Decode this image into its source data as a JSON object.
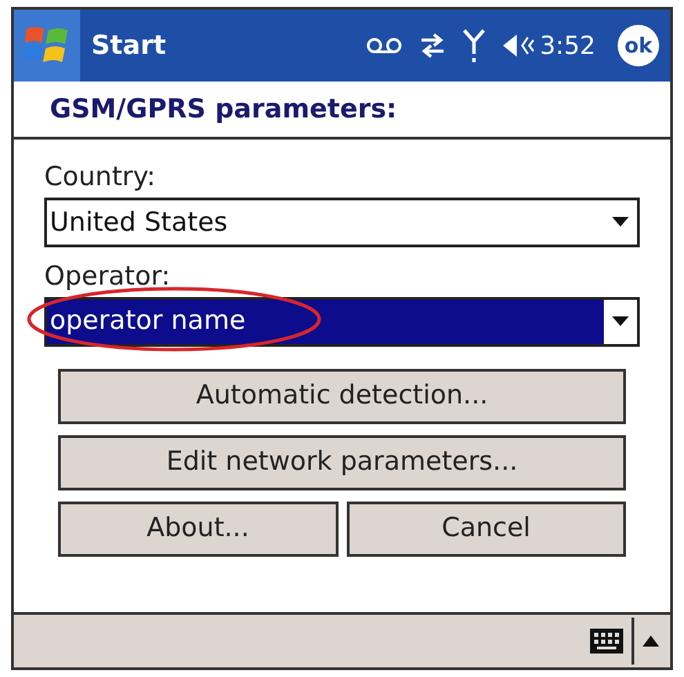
{
  "title_bar": {
    "title": "Start",
    "time": "3:52",
    "ok": "ok"
  },
  "header": "GSM/GPRS parameters:",
  "fields": [
    {
      "label": "Country:",
      "value": "United States",
      "selected": false,
      "circled": false
    },
    {
      "label": "Operator:",
      "value": "operator name",
      "selected": true,
      "circled": true
    }
  ],
  "buttons": [
    [
      "Automatic detection..."
    ],
    [
      "Edit network parameters..."
    ],
    [
      "About...",
      "Cancel"
    ]
  ]
}
